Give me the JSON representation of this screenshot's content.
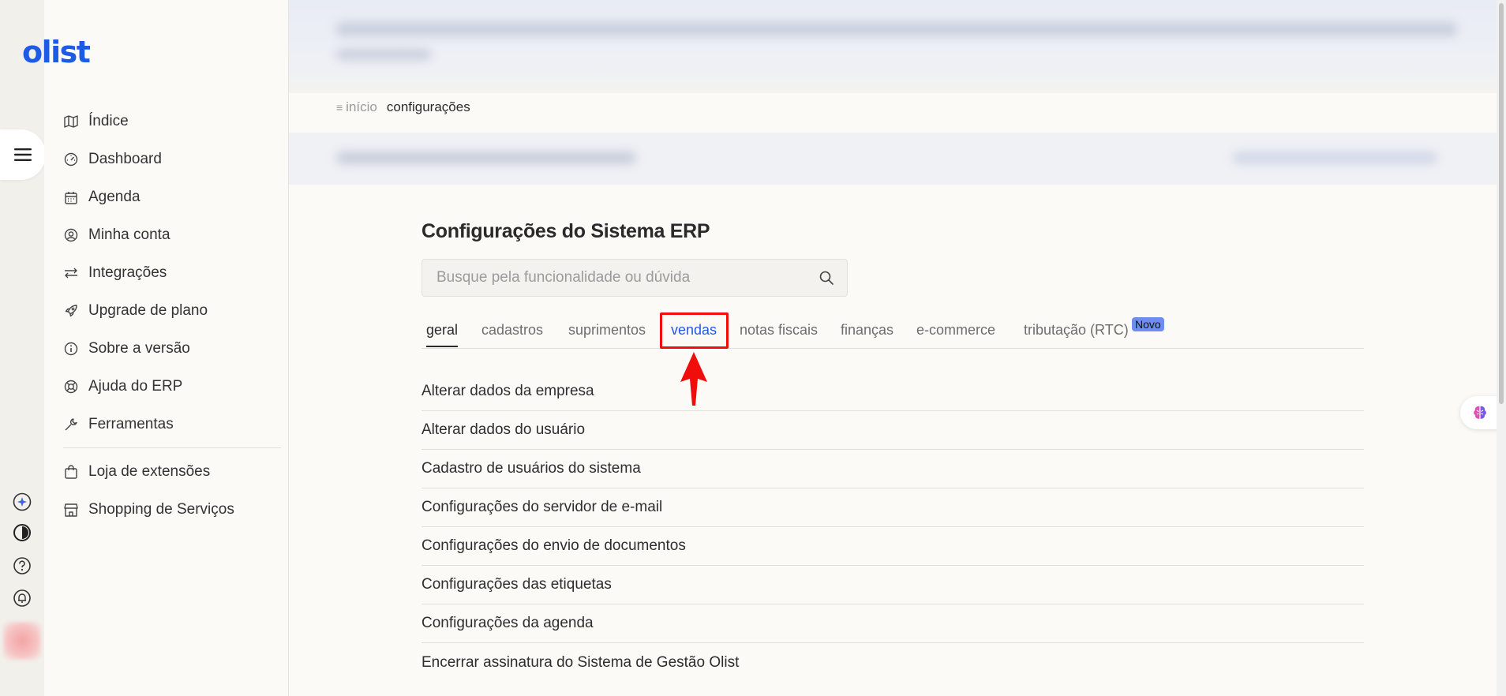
{
  "app": {
    "logo": "olist"
  },
  "sidebar": {
    "items": [
      {
        "label": "Índice",
        "icon": "map-icon"
      },
      {
        "label": "Dashboard",
        "icon": "gauge-icon"
      },
      {
        "label": "Agenda",
        "icon": "calendar-icon"
      },
      {
        "label": "Minha conta",
        "icon": "user-circle-icon"
      },
      {
        "label": "Integrações",
        "icon": "arrows-icon"
      },
      {
        "label": "Upgrade de plano",
        "icon": "rocket-icon"
      },
      {
        "label": "Sobre a versão",
        "icon": "info-icon"
      },
      {
        "label": "Ajuda do ERP",
        "icon": "lifebuoy-icon"
      },
      {
        "label": "Ferramentas",
        "icon": "wrench-icon"
      }
    ],
    "extra_items": [
      {
        "label": "Loja de extensões",
        "icon": "bag-icon"
      },
      {
        "label": "Shopping de Serviços",
        "icon": "store-icon"
      }
    ]
  },
  "breadcrumb": {
    "home": "início",
    "current": "configurações"
  },
  "page": {
    "title": "Configurações do Sistema ERP",
    "search_placeholder": "Busque pela funcionalidade ou dúvida"
  },
  "tabs": [
    {
      "label": "geral",
      "state": "active"
    },
    {
      "label": "cadastros"
    },
    {
      "label": "suprimentos"
    },
    {
      "label": "vendas",
      "state": "highlighted"
    },
    {
      "label": "notas fiscais"
    },
    {
      "label": "finanças"
    },
    {
      "label": "e-commerce"
    },
    {
      "label": "tributação (RTC)",
      "badge": "Novo"
    }
  ],
  "list": [
    "Alterar dados da empresa",
    "Alterar dados do usuário",
    "Cadastro de usuários do sistema",
    "Configurações do servidor de e-mail",
    "Configurações do envio de documentos",
    "Configurações das etiquetas",
    "Configurações da agenda",
    "Encerrar assinatura do Sistema de Gestão Olist"
  ],
  "colors": {
    "brand": "#1d5be6",
    "highlight": "#f20d0d",
    "badge": "#6d8ef0"
  }
}
